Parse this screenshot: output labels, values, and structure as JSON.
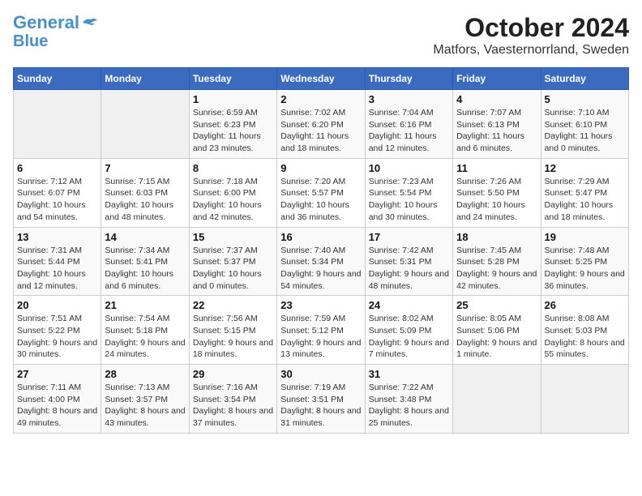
{
  "logo": {
    "line1": "General",
    "line2": "Blue"
  },
  "title": "October 2024",
  "subtitle": "Matfors, Vaesternorrland, Sweden",
  "weekdays": [
    "Sunday",
    "Monday",
    "Tuesday",
    "Wednesday",
    "Thursday",
    "Friday",
    "Saturday"
  ],
  "weeks": [
    [
      {
        "day": "",
        "sunrise": "",
        "sunset": "",
        "daylight": ""
      },
      {
        "day": "",
        "sunrise": "",
        "sunset": "",
        "daylight": ""
      },
      {
        "day": "1",
        "sunrise": "Sunrise: 6:59 AM",
        "sunset": "Sunset: 6:23 PM",
        "daylight": "Daylight: 11 hours and 23 minutes."
      },
      {
        "day": "2",
        "sunrise": "Sunrise: 7:02 AM",
        "sunset": "Sunset: 6:20 PM",
        "daylight": "Daylight: 11 hours and 18 minutes."
      },
      {
        "day": "3",
        "sunrise": "Sunrise: 7:04 AM",
        "sunset": "Sunset: 6:16 PM",
        "daylight": "Daylight: 11 hours and 12 minutes."
      },
      {
        "day": "4",
        "sunrise": "Sunrise: 7:07 AM",
        "sunset": "Sunset: 6:13 PM",
        "daylight": "Daylight: 11 hours and 6 minutes."
      },
      {
        "day": "5",
        "sunrise": "Sunrise: 7:10 AM",
        "sunset": "Sunset: 6:10 PM",
        "daylight": "Daylight: 11 hours and 0 minutes."
      }
    ],
    [
      {
        "day": "6",
        "sunrise": "Sunrise: 7:12 AM",
        "sunset": "Sunset: 6:07 PM",
        "daylight": "Daylight: 10 hours and 54 minutes."
      },
      {
        "day": "7",
        "sunrise": "Sunrise: 7:15 AM",
        "sunset": "Sunset: 6:03 PM",
        "daylight": "Daylight: 10 hours and 48 minutes."
      },
      {
        "day": "8",
        "sunrise": "Sunrise: 7:18 AM",
        "sunset": "Sunset: 6:00 PM",
        "daylight": "Daylight: 10 hours and 42 minutes."
      },
      {
        "day": "9",
        "sunrise": "Sunrise: 7:20 AM",
        "sunset": "Sunset: 5:57 PM",
        "daylight": "Daylight: 10 hours and 36 minutes."
      },
      {
        "day": "10",
        "sunrise": "Sunrise: 7:23 AM",
        "sunset": "Sunset: 5:54 PM",
        "daylight": "Daylight: 10 hours and 30 minutes."
      },
      {
        "day": "11",
        "sunrise": "Sunrise: 7:26 AM",
        "sunset": "Sunset: 5:50 PM",
        "daylight": "Daylight: 10 hours and 24 minutes."
      },
      {
        "day": "12",
        "sunrise": "Sunrise: 7:29 AM",
        "sunset": "Sunset: 5:47 PM",
        "daylight": "Daylight: 10 hours and 18 minutes."
      }
    ],
    [
      {
        "day": "13",
        "sunrise": "Sunrise: 7:31 AM",
        "sunset": "Sunset: 5:44 PM",
        "daylight": "Daylight: 10 hours and 12 minutes."
      },
      {
        "day": "14",
        "sunrise": "Sunrise: 7:34 AM",
        "sunset": "Sunset: 5:41 PM",
        "daylight": "Daylight: 10 hours and 6 minutes."
      },
      {
        "day": "15",
        "sunrise": "Sunrise: 7:37 AM",
        "sunset": "Sunset: 5:37 PM",
        "daylight": "Daylight: 10 hours and 0 minutes."
      },
      {
        "day": "16",
        "sunrise": "Sunrise: 7:40 AM",
        "sunset": "Sunset: 5:34 PM",
        "daylight": "Daylight: 9 hours and 54 minutes."
      },
      {
        "day": "17",
        "sunrise": "Sunrise: 7:42 AM",
        "sunset": "Sunset: 5:31 PM",
        "daylight": "Daylight: 9 hours and 48 minutes."
      },
      {
        "day": "18",
        "sunrise": "Sunrise: 7:45 AM",
        "sunset": "Sunset: 5:28 PM",
        "daylight": "Daylight: 9 hours and 42 minutes."
      },
      {
        "day": "19",
        "sunrise": "Sunrise: 7:48 AM",
        "sunset": "Sunset: 5:25 PM",
        "daylight": "Daylight: 9 hours and 36 minutes."
      }
    ],
    [
      {
        "day": "20",
        "sunrise": "Sunrise: 7:51 AM",
        "sunset": "Sunset: 5:22 PM",
        "daylight": "Daylight: 9 hours and 30 minutes."
      },
      {
        "day": "21",
        "sunrise": "Sunrise: 7:54 AM",
        "sunset": "Sunset: 5:18 PM",
        "daylight": "Daylight: 9 hours and 24 minutes."
      },
      {
        "day": "22",
        "sunrise": "Sunrise: 7:56 AM",
        "sunset": "Sunset: 5:15 PM",
        "daylight": "Daylight: 9 hours and 18 minutes."
      },
      {
        "day": "23",
        "sunrise": "Sunrise: 7:59 AM",
        "sunset": "Sunset: 5:12 PM",
        "daylight": "Daylight: 9 hours and 13 minutes."
      },
      {
        "day": "24",
        "sunrise": "Sunrise: 8:02 AM",
        "sunset": "Sunset: 5:09 PM",
        "daylight": "Daylight: 9 hours and 7 minutes."
      },
      {
        "day": "25",
        "sunrise": "Sunrise: 8:05 AM",
        "sunset": "Sunset: 5:06 PM",
        "daylight": "Daylight: 9 hours and 1 minute."
      },
      {
        "day": "26",
        "sunrise": "Sunrise: 8:08 AM",
        "sunset": "Sunset: 5:03 PM",
        "daylight": "Daylight: 8 hours and 55 minutes."
      }
    ],
    [
      {
        "day": "27",
        "sunrise": "Sunrise: 7:11 AM",
        "sunset": "Sunset: 4:00 PM",
        "daylight": "Daylight: 8 hours and 49 minutes."
      },
      {
        "day": "28",
        "sunrise": "Sunrise: 7:13 AM",
        "sunset": "Sunset: 3:57 PM",
        "daylight": "Daylight: 8 hours and 43 minutes."
      },
      {
        "day": "29",
        "sunrise": "Sunrise: 7:16 AM",
        "sunset": "Sunset: 3:54 PM",
        "daylight": "Daylight: 8 hours and 37 minutes."
      },
      {
        "day": "30",
        "sunrise": "Sunrise: 7:19 AM",
        "sunset": "Sunset: 3:51 PM",
        "daylight": "Daylight: 8 hours and 31 minutes."
      },
      {
        "day": "31",
        "sunrise": "Sunrise: 7:22 AM",
        "sunset": "Sunset: 3:48 PM",
        "daylight": "Daylight: 8 hours and 25 minutes."
      },
      {
        "day": "",
        "sunrise": "",
        "sunset": "",
        "daylight": ""
      },
      {
        "day": "",
        "sunrise": "",
        "sunset": "",
        "daylight": ""
      }
    ]
  ]
}
